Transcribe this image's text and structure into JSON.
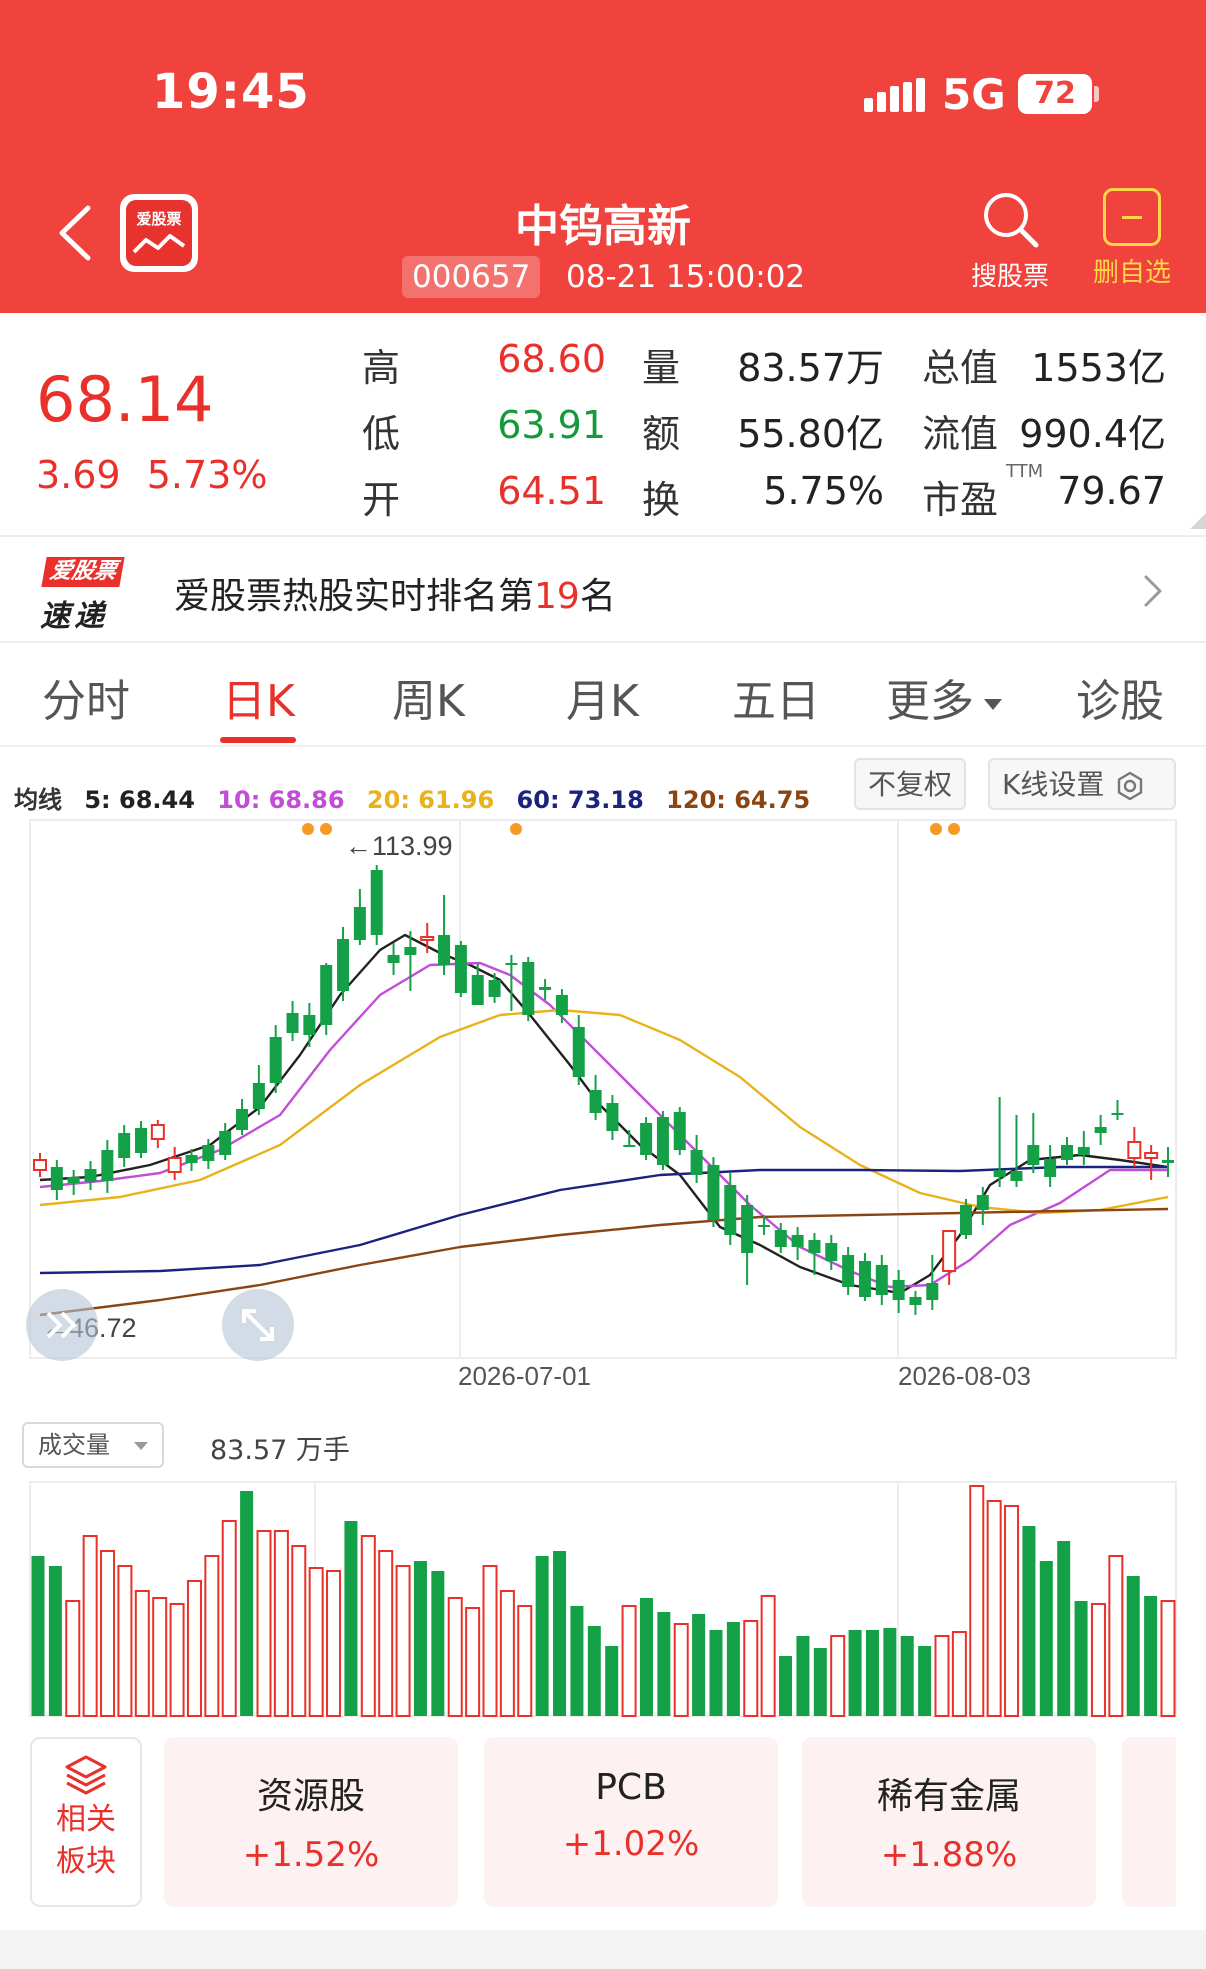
{
  "status_bar": {
    "time": "19:45",
    "network": "5G",
    "battery": "72"
  },
  "header": {
    "logo_text": "爱股票",
    "stock_name": "中钨高新",
    "stock_code": "000657",
    "timestamp": "08-21 15:00:02",
    "search_label": "搜股票",
    "favorite_label": "删自选",
    "accent_color": "#f0433d"
  },
  "quote": {
    "price": "68.14",
    "change": "3.69",
    "change_pct": "5.73%",
    "rows": [
      {
        "l1": "高",
        "v1": "68.60",
        "l2": "量",
        "v2": "83.57万",
        "l3": "总值",
        "v3": "1553亿"
      },
      {
        "l1": "低",
        "v1": "63.91",
        "l2": "额",
        "v2": "55.80亿",
        "l3": "流值",
        "v3": "990.4亿"
      },
      {
        "l1": "开",
        "v1": "64.51",
        "l2": "换",
        "v2": "5.75%",
        "l3": "市盈",
        "v3": "79.67"
      }
    ],
    "ttm": "TTM"
  },
  "hot_banner": {
    "logo_top": "爱股票",
    "logo_bottom": "速递",
    "text_prefix": "爱股票热股实时排名第",
    "rank": "19",
    "text_suffix": "名"
  },
  "tabs": [
    {
      "label": "分时"
    },
    {
      "label": "日K"
    },
    {
      "label": "周K"
    },
    {
      "label": "月K"
    },
    {
      "label": "五日"
    },
    {
      "label": "更多"
    },
    {
      "label": "诊股"
    }
  ],
  "ma": {
    "title": "均线",
    "items": [
      {
        "text": "5: 68.44",
        "color": "#222222"
      },
      {
        "text": "10: 68.86",
        "color": "#c24dd6"
      },
      {
        "text": "20: 61.96",
        "color": "#e9b21a"
      },
      {
        "text": "60: 73.18",
        "color": "#1a237e"
      },
      {
        "text": "120: 64.75",
        "color": "#8b4513"
      }
    ],
    "adjust_label": "不复权",
    "kline_settings_label": "K线设置"
  },
  "chart_data": {
    "type": "candlestick",
    "high_label": "←113.99",
    "low_label": "←46.72",
    "x_ticks": [
      "2026-07-01",
      "2026-08-03"
    ],
    "up_color": "#e9302a",
    "down_color": "#14a046"
  },
  "volume": {
    "selector": "成交量",
    "value_text": "83.57 万手"
  },
  "sectors": {
    "related_label_1": "相关",
    "related_label_2": "板块",
    "cards": [
      {
        "name": "资源股",
        "change": "+1.52%"
      },
      {
        "name": "PCB",
        "change": "+1.02%"
      },
      {
        "name": "稀有金属",
        "change": "+1.88%"
      }
    ]
  }
}
